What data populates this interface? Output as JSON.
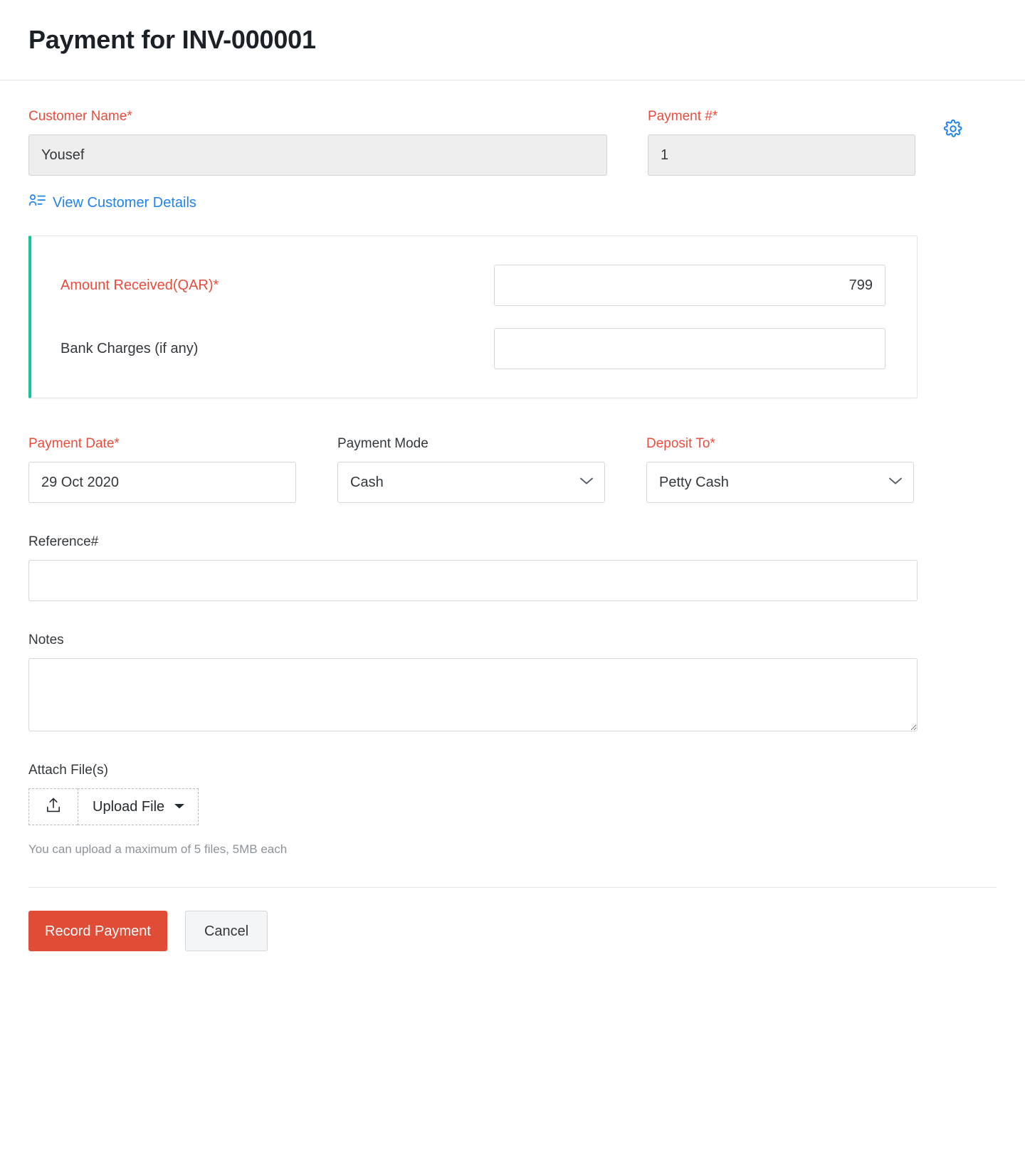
{
  "header": {
    "title": "Payment for INV-000001"
  },
  "customer": {
    "label": "Customer Name*",
    "value": "Yousef",
    "placeholder": "",
    "view_details_link": "View Customer Details",
    "icon": "contact-details-icon"
  },
  "payment_number": {
    "label": "Payment #*",
    "value": "1",
    "settings_icon": "gear-icon"
  },
  "amount_card": {
    "accent_color": "#0ec99a",
    "rows": [
      {
        "label": "Amount Received(QAR)*",
        "required": true,
        "value": "799",
        "align": "right"
      },
      {
        "label": "Bank Charges (if any)",
        "required": false,
        "value": "",
        "align": "right"
      }
    ]
  },
  "payment_date": {
    "label": "Payment Date*",
    "value": "29 Oct 2020"
  },
  "payment_mode": {
    "label": "Payment Mode",
    "value": "Cash",
    "options": [
      "Cash"
    ],
    "icon": "chevron-down-icon"
  },
  "deposit_to": {
    "label": "Deposit To*",
    "value": "Petty Cash",
    "options": [
      "Petty Cash"
    ],
    "icon": "chevron-down-icon"
  },
  "reference": {
    "label": "Reference#",
    "value": "",
    "placeholder": ""
  },
  "notes": {
    "label": "Notes",
    "value": "",
    "placeholder": ""
  },
  "attachments": {
    "label": "Attach File(s)",
    "button_label": "Upload File",
    "upload_icon": "upload-icon",
    "caret_icon": "caret-down-icon",
    "hint": "You can upload a maximum of 5 files, 5MB each"
  },
  "footer": {
    "primary_label": "Record Payment",
    "secondary_label": "Cancel",
    "primary_color": "#e04c35"
  }
}
